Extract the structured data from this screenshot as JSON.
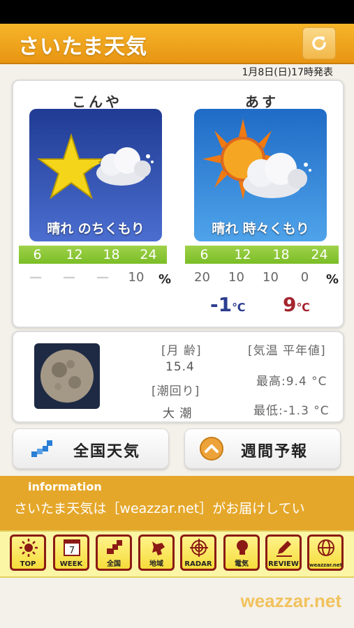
{
  "header": {
    "title": "さいたま天気"
  },
  "issued": "1月8日(日)17時発表",
  "forecast": {
    "tonight": {
      "title": "こんや",
      "weather": "晴れ のちくもり",
      "hours": [
        "6",
        "12",
        "18",
        "24"
      ],
      "pops": [
        "—",
        "—",
        "—",
        "10"
      ]
    },
    "tomorrow": {
      "title": "あす",
      "weather": "晴れ 時々くもり",
      "hours": [
        "6",
        "12",
        "18",
        "24"
      ],
      "pops": [
        "20",
        "10",
        "10",
        "0"
      ],
      "min_temp": "-1",
      "max_temp": "9",
      "unit": "℃"
    },
    "pct": "%"
  },
  "info": {
    "moon_age_label": "[月 齢]",
    "moon_age": "15.4",
    "tide_label": "[潮回り]",
    "tide": "大 潮",
    "normal_label": "[気温 平年値]",
    "normal_high": "最高:9.4 °C",
    "normal_low": "最低:-1.3 °C"
  },
  "buttons": {
    "national": "全国天気",
    "weekly": "週間予報"
  },
  "information": {
    "title": "information",
    "text": "さいたま天気は［weazzar.net］がお届けしてい"
  },
  "toolbar": [
    {
      "label": "TOP",
      "icon": "sun-icon"
    },
    {
      "label": "WEEK",
      "icon": "calendar-icon",
      "number": "7"
    },
    {
      "label": "全国",
      "icon": "japan-map-icon"
    },
    {
      "label": "地域",
      "icon": "hokkaido-map-icon"
    },
    {
      "label": "RADAR",
      "icon": "radar-icon"
    },
    {
      "label": "電気",
      "icon": "bulb-icon"
    },
    {
      "label": "REVIEW",
      "icon": "pencil-icon"
    },
    {
      "label": "weazzar.net",
      "icon": "globe-icon"
    }
  ],
  "footer": {
    "logo": "weazzar.net"
  },
  "colors": {
    "header": "#f0a21e",
    "accent_green": "#8cc63f",
    "min_temp": "#2b3d8f",
    "max_temp": "#a4242e",
    "toolbar_border": "#8b1a14"
  }
}
